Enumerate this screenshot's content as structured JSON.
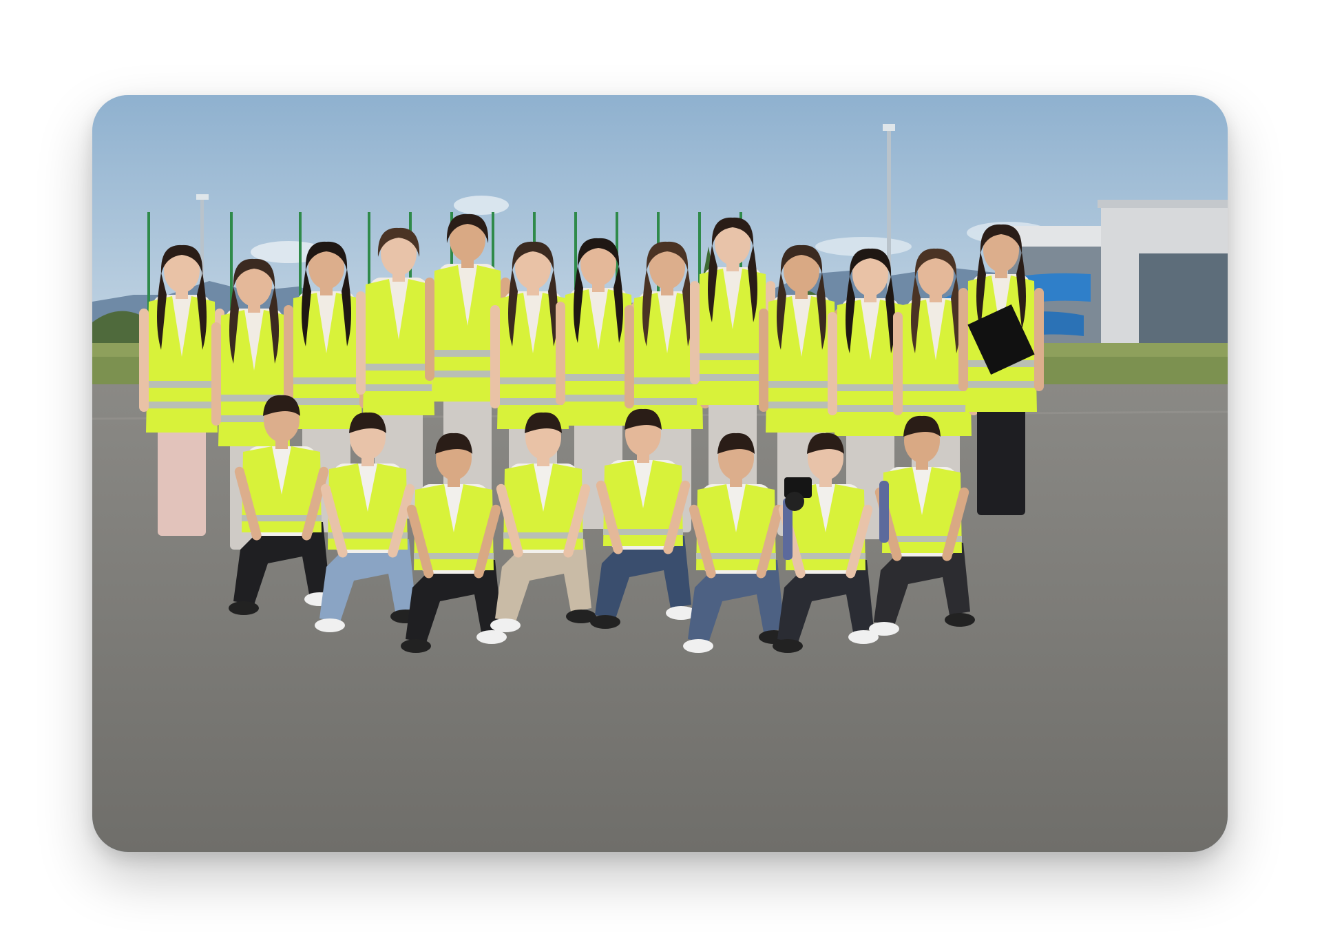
{
  "photo": {
    "subject": "group-photo",
    "people_standing": 13,
    "people_crouching": 8,
    "colors": {
      "sky_top": "#8fb1cf",
      "sky_bottom": "#c9dbe8",
      "mountains": "#6f8aa6",
      "vest": "#d8f23a",
      "vest_stripe": "#b9bfb4",
      "asphalt": "#7d7c78",
      "fence_pole": "#2f8a4a",
      "building": "#d9dcdf",
      "slide": "#2f7fc9"
    }
  }
}
